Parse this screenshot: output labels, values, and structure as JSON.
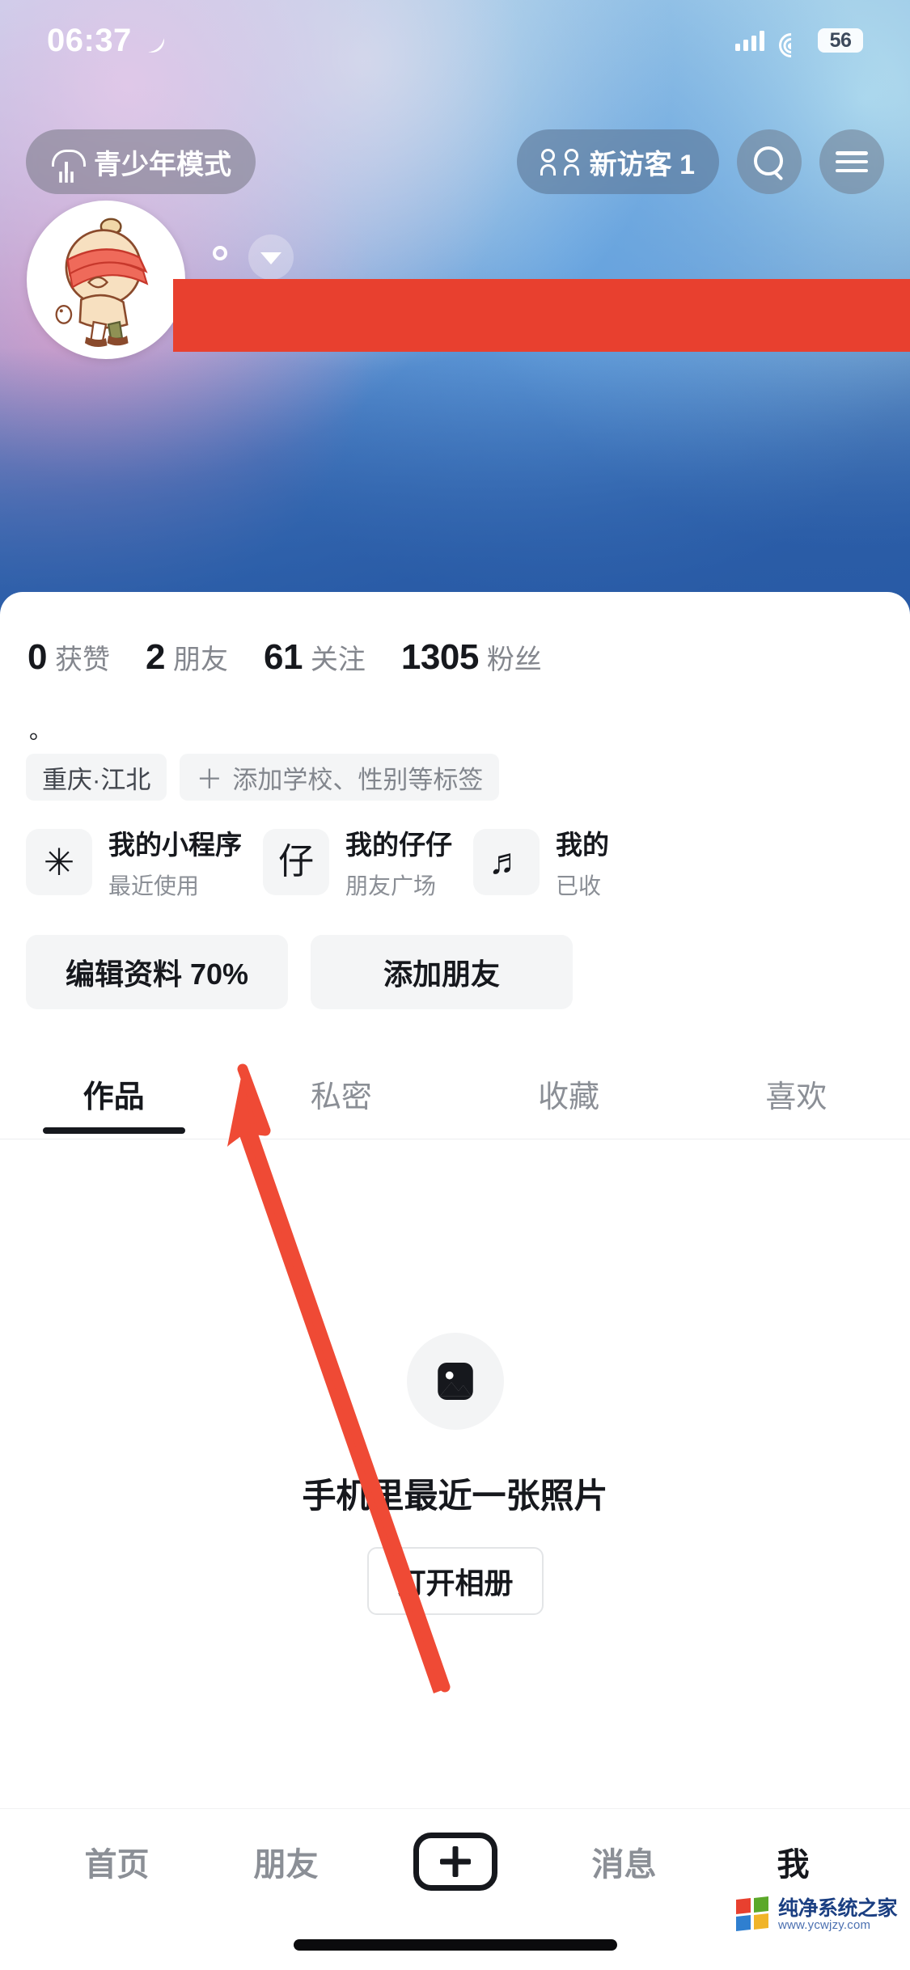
{
  "status_bar": {
    "time": "06:37",
    "moon_icon": "moon-icon",
    "signal_icon": "cellular-signal-icon",
    "wifi_icon": "wifi-icon",
    "battery_level": "56"
  },
  "top_nav": {
    "teen_mode_label": "青少年模式",
    "teen_mode_icon": "umbrella-icon",
    "visitor_label": "新访客 1",
    "visitor_icon": "people-icon",
    "search_icon": "search-icon",
    "menu_icon": "hamburger-menu-icon"
  },
  "profile": {
    "avatar_alt": "卡通头像",
    "name_redacted": true,
    "gender_dot_icon": "gender-dot-icon",
    "expand_icon": "chevron-down-icon",
    "bio": "。",
    "stats": [
      {
        "value": "0",
        "label": "获赞"
      },
      {
        "value": "2",
        "label": "朋友"
      },
      {
        "value": "61",
        "label": "关注"
      },
      {
        "value": "1305",
        "label": "粉丝"
      }
    ],
    "tags": [
      {
        "text": "重庆·江北",
        "type": "location"
      },
      {
        "text": "添加学校、性别等标签",
        "type": "add",
        "prefix": "＋"
      }
    ],
    "cards": [
      {
        "icon": "asterisk-icon",
        "glyph": "✳",
        "title": "我的小程序",
        "subtitle": "最近使用"
      },
      {
        "icon": "zaizai-icon",
        "glyph": "仔",
        "title": "我的仔仔",
        "subtitle": "朋友广场"
      },
      {
        "icon": "music-icon",
        "glyph": "♬",
        "title": "我的",
        "subtitle": "已收"
      }
    ],
    "actions": [
      {
        "label": "编辑资料 70%",
        "name": "edit-profile-button"
      },
      {
        "label": "添加朋友",
        "name": "add-friend-button"
      }
    ]
  },
  "tabs": [
    {
      "label": "作品",
      "active": true
    },
    {
      "label": "私密",
      "active": false
    },
    {
      "label": "收藏",
      "active": false
    },
    {
      "label": "喜欢",
      "active": false
    }
  ],
  "empty_state": {
    "icon": "image-placeholder-icon",
    "title": "手机里最近一张照片",
    "button_label": "打开相册"
  },
  "bottom_nav": {
    "items": [
      {
        "label": "首页",
        "active": false
      },
      {
        "label": "朋友",
        "active": false
      },
      {
        "label": "＋",
        "active": false,
        "is_plus": true
      },
      {
        "label": "消息",
        "active": false
      },
      {
        "label": "我",
        "active": true
      }
    ]
  },
  "annotation": {
    "arrow_color": "#ef4a35",
    "points_to": "编辑资料 70%"
  },
  "watermark": {
    "title": "纯净系统之家",
    "url": "www.ycwjzy.com"
  },
  "colors": {
    "accent_red": "#e8402f",
    "text_primary": "#16181d",
    "text_secondary": "#8b8f96",
    "chip_bg": "#f4f5f6",
    "cover_blue": "#2f62ad"
  }
}
